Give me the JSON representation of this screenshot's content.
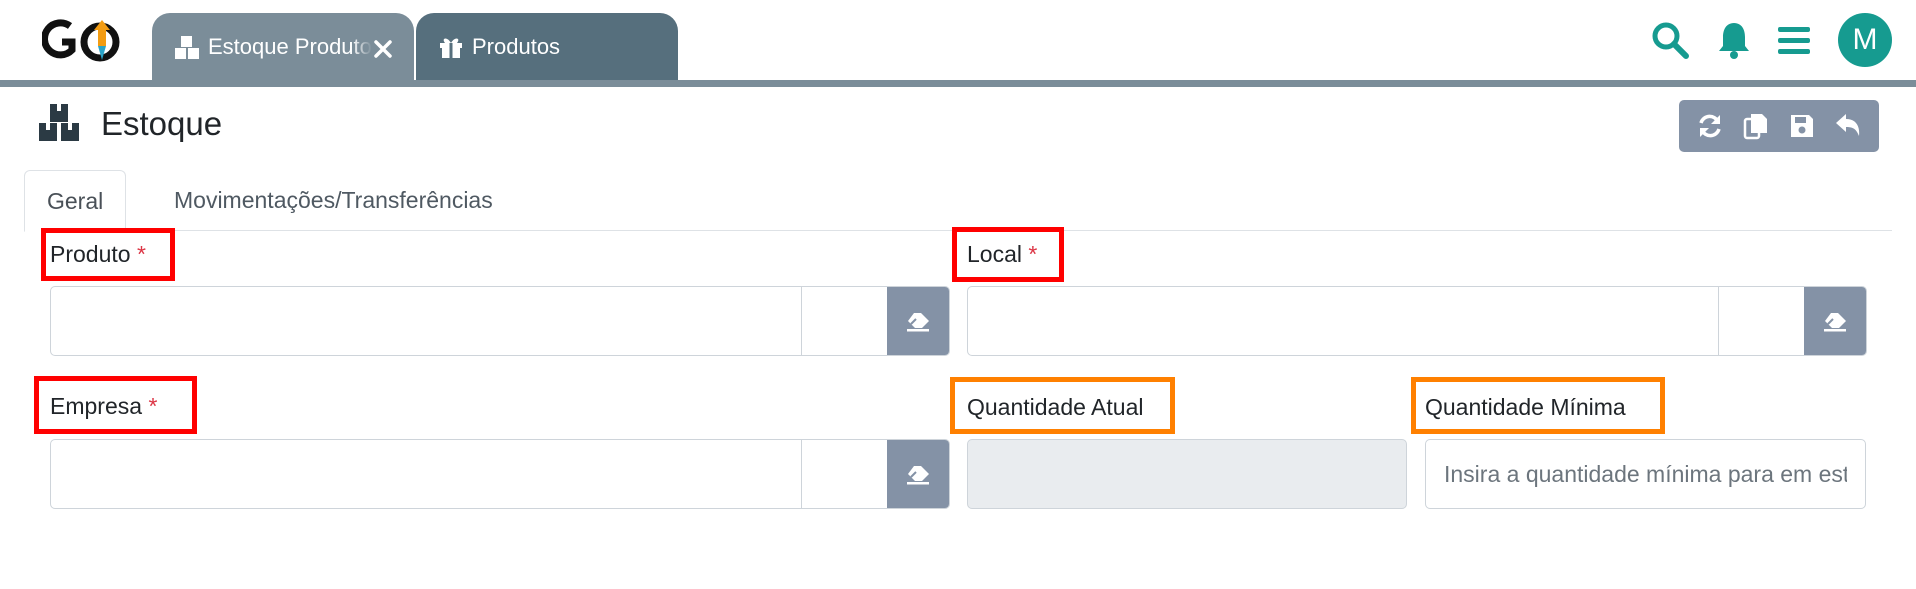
{
  "app": {
    "logo_text": "GO"
  },
  "tabs": [
    {
      "label": "Estoque Produtos",
      "icon": "boxes-icon",
      "active": true
    },
    {
      "label": "Produtos",
      "icon": "gift-icon",
      "active": false
    }
  ],
  "header_icons": [
    "search-icon",
    "bell-icon",
    "menu-icon"
  ],
  "user": {
    "avatar_initial": "M"
  },
  "page": {
    "title": "Estoque",
    "icon": "boxes-icon"
  },
  "toolbar": {
    "buttons": [
      "refresh-icon",
      "copy-icon",
      "save-icon",
      "undo-icon"
    ]
  },
  "form_tabs": [
    {
      "label": "Geral",
      "active": true
    },
    {
      "label": "Movimentações/Transferências",
      "active": false
    }
  ],
  "form": {
    "produto": {
      "label": "Produto",
      "required": "*",
      "value": ""
    },
    "local": {
      "label": "Local",
      "required": "*",
      "value": ""
    },
    "empresa": {
      "label": "Empresa",
      "required": "*",
      "value": ""
    },
    "quantidade_atual": {
      "label": "Quantidade Atual",
      "value": ""
    },
    "quantidade_minima": {
      "label": "Quantidade Mínima",
      "value": "",
      "placeholder": "Insira a quantidade mínima para em estoque"
    }
  },
  "colors": {
    "teal": "#169b90",
    "tab_active": "#7b8d99",
    "tab_inactive": "#566f7d",
    "button_gray": "#8492a6",
    "required": "#dc3545",
    "highlight_red": "#ff0000",
    "highlight_orange": "#ff8000"
  }
}
